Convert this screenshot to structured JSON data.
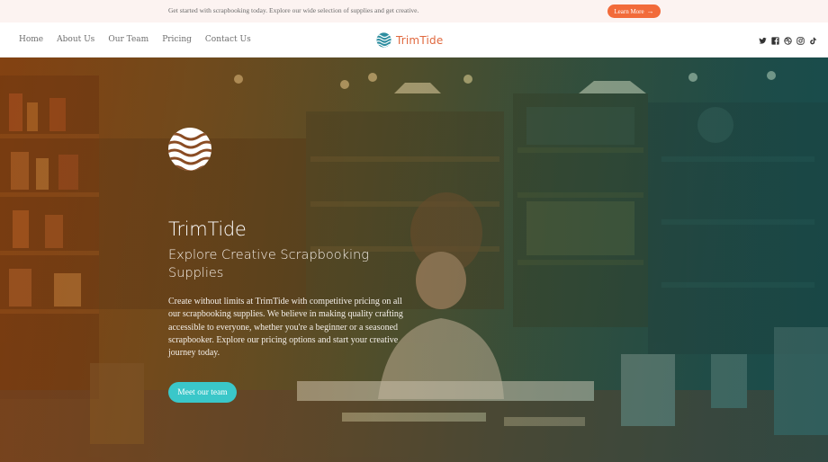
{
  "announcement": {
    "text": "Get started with scrapbooking today. Explore our wide selection of supplies and get creative.",
    "button_label": "Learn More",
    "button_icon": "arrow-right-icon",
    "accent": "#f26b3a"
  },
  "nav": {
    "items": [
      {
        "label": "Home"
      },
      {
        "label": "About Us"
      },
      {
        "label": "Our Team"
      },
      {
        "label": "Pricing"
      },
      {
        "label": "Contact Us"
      }
    ]
  },
  "brand": {
    "name": "TrimTide",
    "logo_icon": "wave-globe-icon",
    "color": "#e0683e",
    "logo_color": "#2e8ea0"
  },
  "socials": [
    {
      "icon": "twitter-icon"
    },
    {
      "icon": "facebook-icon"
    },
    {
      "icon": "dribbble-icon"
    },
    {
      "icon": "instagram-icon"
    },
    {
      "icon": "tiktok-icon"
    }
  ],
  "hero": {
    "title": "TrimTide",
    "subtitle": "Explore Creative Scrapbooking Supplies",
    "body": "Create without limits at TrimTide with competitive pricing on all our scrapbooking supplies. We believe in making quality crafting accessible to everyone, whether you're a beginner or a seasoned scrapbooker. Explore our pricing options and start your creative journey today.",
    "button_label": "Meet our team",
    "button_color": "#3ac7c9",
    "logo_icon": "wave-globe-icon"
  }
}
